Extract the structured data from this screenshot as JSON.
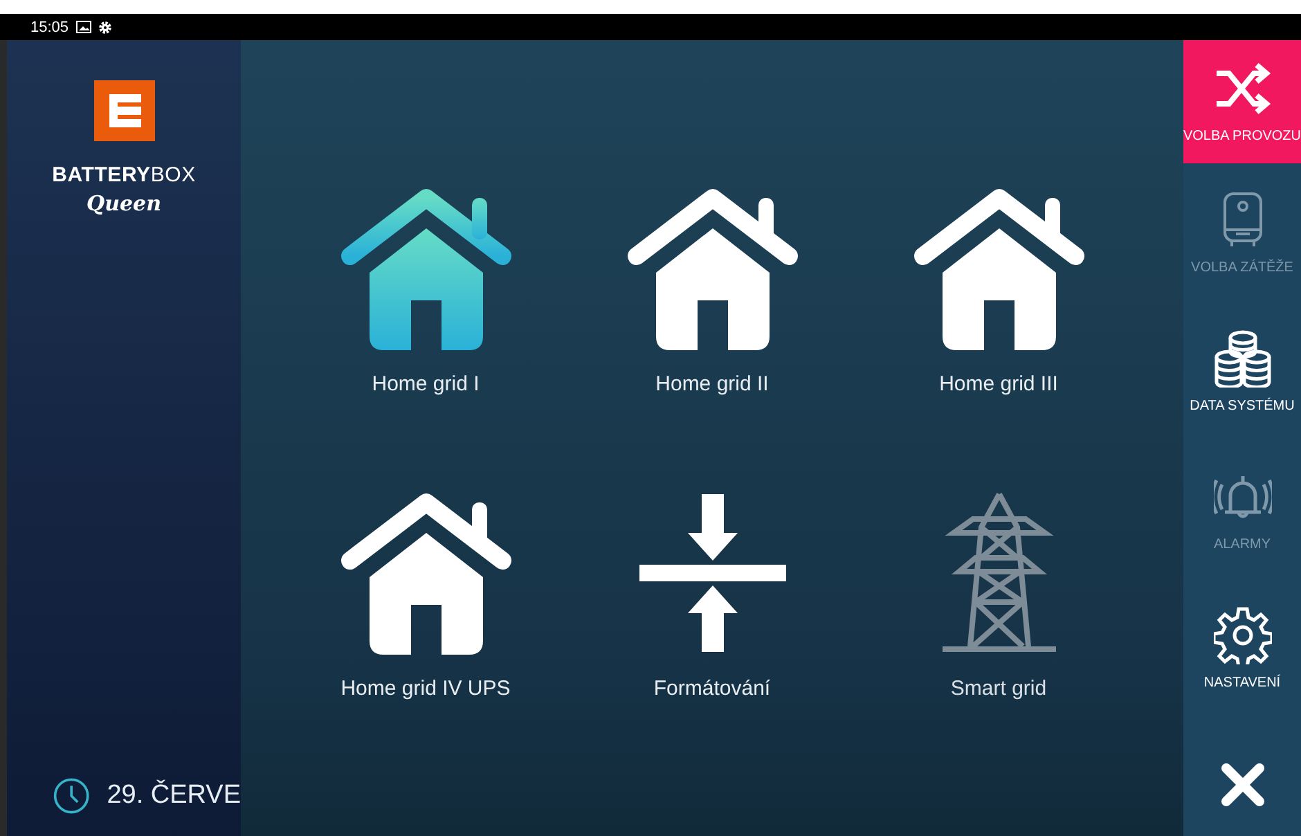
{
  "status_bar": {
    "time": "15:05"
  },
  "brand": {
    "name": "**BATTERY**BOX",
    "model": "Queen"
  },
  "footer": {
    "date": "29. ČERVE"
  },
  "modes": [
    {
      "label": "Home grid I",
      "kind": "house",
      "selected": true,
      "disabled": false
    },
    {
      "label": "Home grid II",
      "kind": "house",
      "selected": false,
      "disabled": false
    },
    {
      "label": "Home grid III",
      "kind": "house",
      "selected": false,
      "disabled": false
    },
    {
      "label": "Home grid IV UPS",
      "kind": "house",
      "selected": false,
      "disabled": false
    },
    {
      "label": "Formátování",
      "kind": "compress",
      "selected": false,
      "disabled": false
    },
    {
      "label": "Smart grid",
      "kind": "pylon",
      "selected": false,
      "disabled": true
    }
  ],
  "sidebar": {
    "items": [
      {
        "label": "VOLBA PROVOZU",
        "kind": "shuffle",
        "selected": true,
        "disabled": false
      },
      {
        "label": "VOLBA ZÁTĚŽE",
        "kind": "boiler",
        "selected": false,
        "disabled": true
      },
      {
        "label": "DATA SYSTÉMU",
        "kind": "database",
        "selected": false,
        "disabled": false
      },
      {
        "label": "ALARMY",
        "kind": "bell",
        "selected": false,
        "disabled": true
      },
      {
        "label": "NASTAVENÍ",
        "kind": "gear",
        "selected": false,
        "disabled": false
      }
    ]
  }
}
